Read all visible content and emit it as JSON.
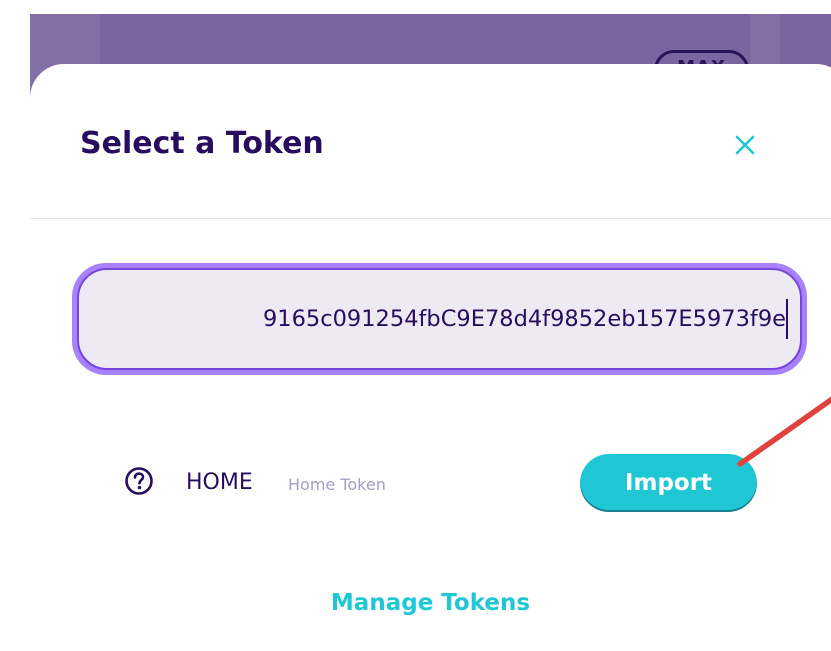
{
  "background": {
    "max_label": "MAX",
    "color": "#7a65a0"
  },
  "modal": {
    "title": "Select a Token",
    "close_icon": "close-icon"
  },
  "search": {
    "value": "9165c091254fbC9E78d4f9852eb157E5973f9e",
    "focus_ring_color": "#a881fc"
  },
  "token_result": {
    "icon": "question-circle-icon",
    "symbol": "HOME",
    "name": "Home Token",
    "import_label": "Import"
  },
  "footer": {
    "manage_tokens_label": "Manage Tokens"
  },
  "colors": {
    "primary_text": "#280d5f",
    "accent": "#1fc7d4",
    "secondary_text": "#a79ec0",
    "annotation_arrow": "#e0423e"
  }
}
